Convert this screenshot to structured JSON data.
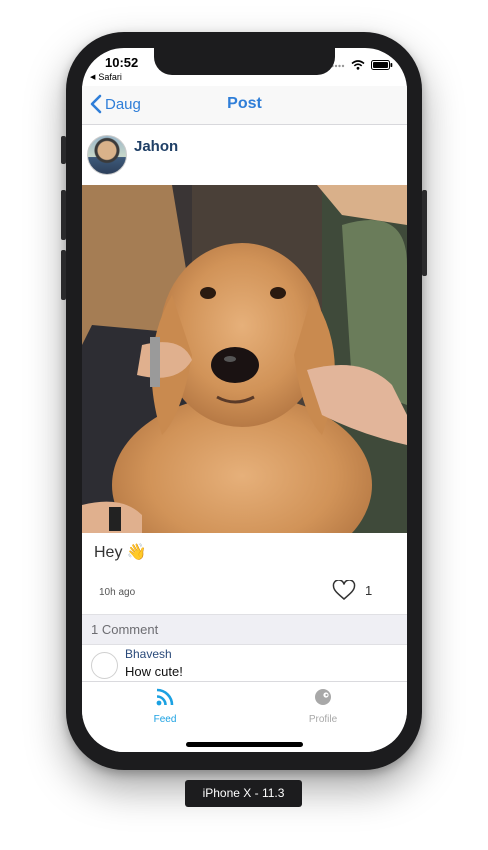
{
  "status": {
    "time": "10:52",
    "carrier": "Safari"
  },
  "nav": {
    "back_label": "Daug",
    "title": "Post"
  },
  "post": {
    "author": "Jahon",
    "caption": "Hey 👋",
    "time_ago": "10h ago",
    "like_count": "1"
  },
  "comments": {
    "header": "1 Comment",
    "items": [
      {
        "user": "Bhavesh",
        "text": "How cute!"
      }
    ]
  },
  "tabs": [
    {
      "label": "Feed",
      "icon": "rss-icon",
      "active": true,
      "color": "#1ba1e2"
    },
    {
      "label": "Profile",
      "icon": "profile-face-icon",
      "active": false,
      "color": "#a8a8a8"
    }
  ],
  "device_label": "iPhone X - 11.3",
  "colors": {
    "accent": "#2f7ed8",
    "tab_active": "#1ba1e2",
    "tab_inactive": "#a8a8a8"
  }
}
